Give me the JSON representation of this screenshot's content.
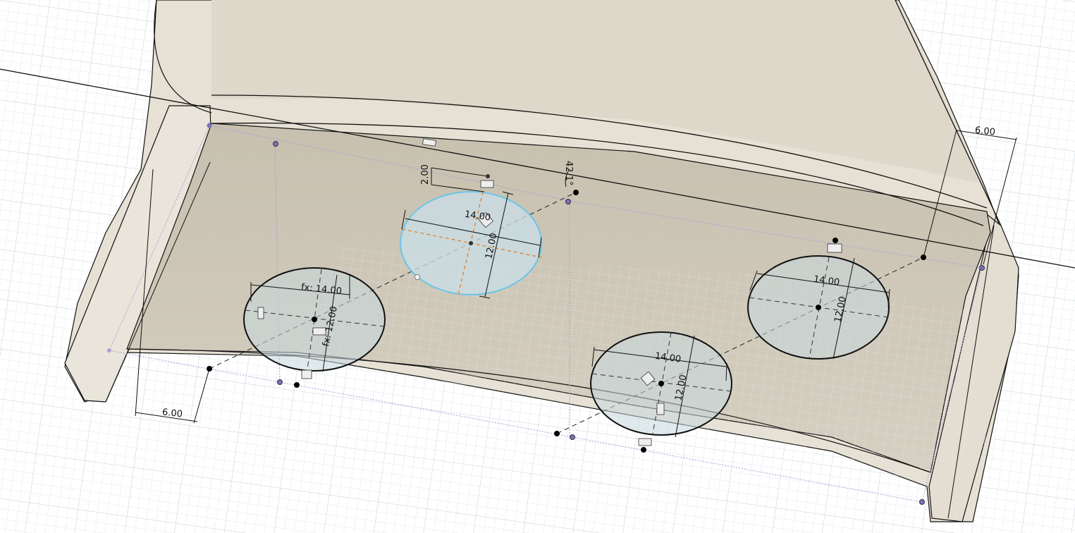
{
  "viewport": {
    "background": "#ffffff",
    "grid_minor_color": "#e6e8ec",
    "grid_major_color": "#cfd3da",
    "body_color": "#e7e2d6",
    "body_shade_color": "#d8d2c2",
    "face_color": "#cfc8b8",
    "sketch_fill": "#c9dde6",
    "selected_outline": "#6cc5e8",
    "constraint_line_color": "#a59ad6",
    "selected_axis_color": "#e07b1f"
  },
  "dimensions": {
    "left_offset": "6.00",
    "right_offset": "6.00",
    "top_offset": "2.00",
    "angle": "42.1°",
    "ellipse_selected": {
      "width": "14.00",
      "height": "12.00"
    },
    "ellipse_left": {
      "width": "fx: 14.00",
      "height": "fx: 12.00"
    },
    "ellipse_bottom": {
      "width": "14.00",
      "height": "12.00"
    },
    "ellipse_right": {
      "width": "14.00",
      "height": "12.00"
    }
  }
}
